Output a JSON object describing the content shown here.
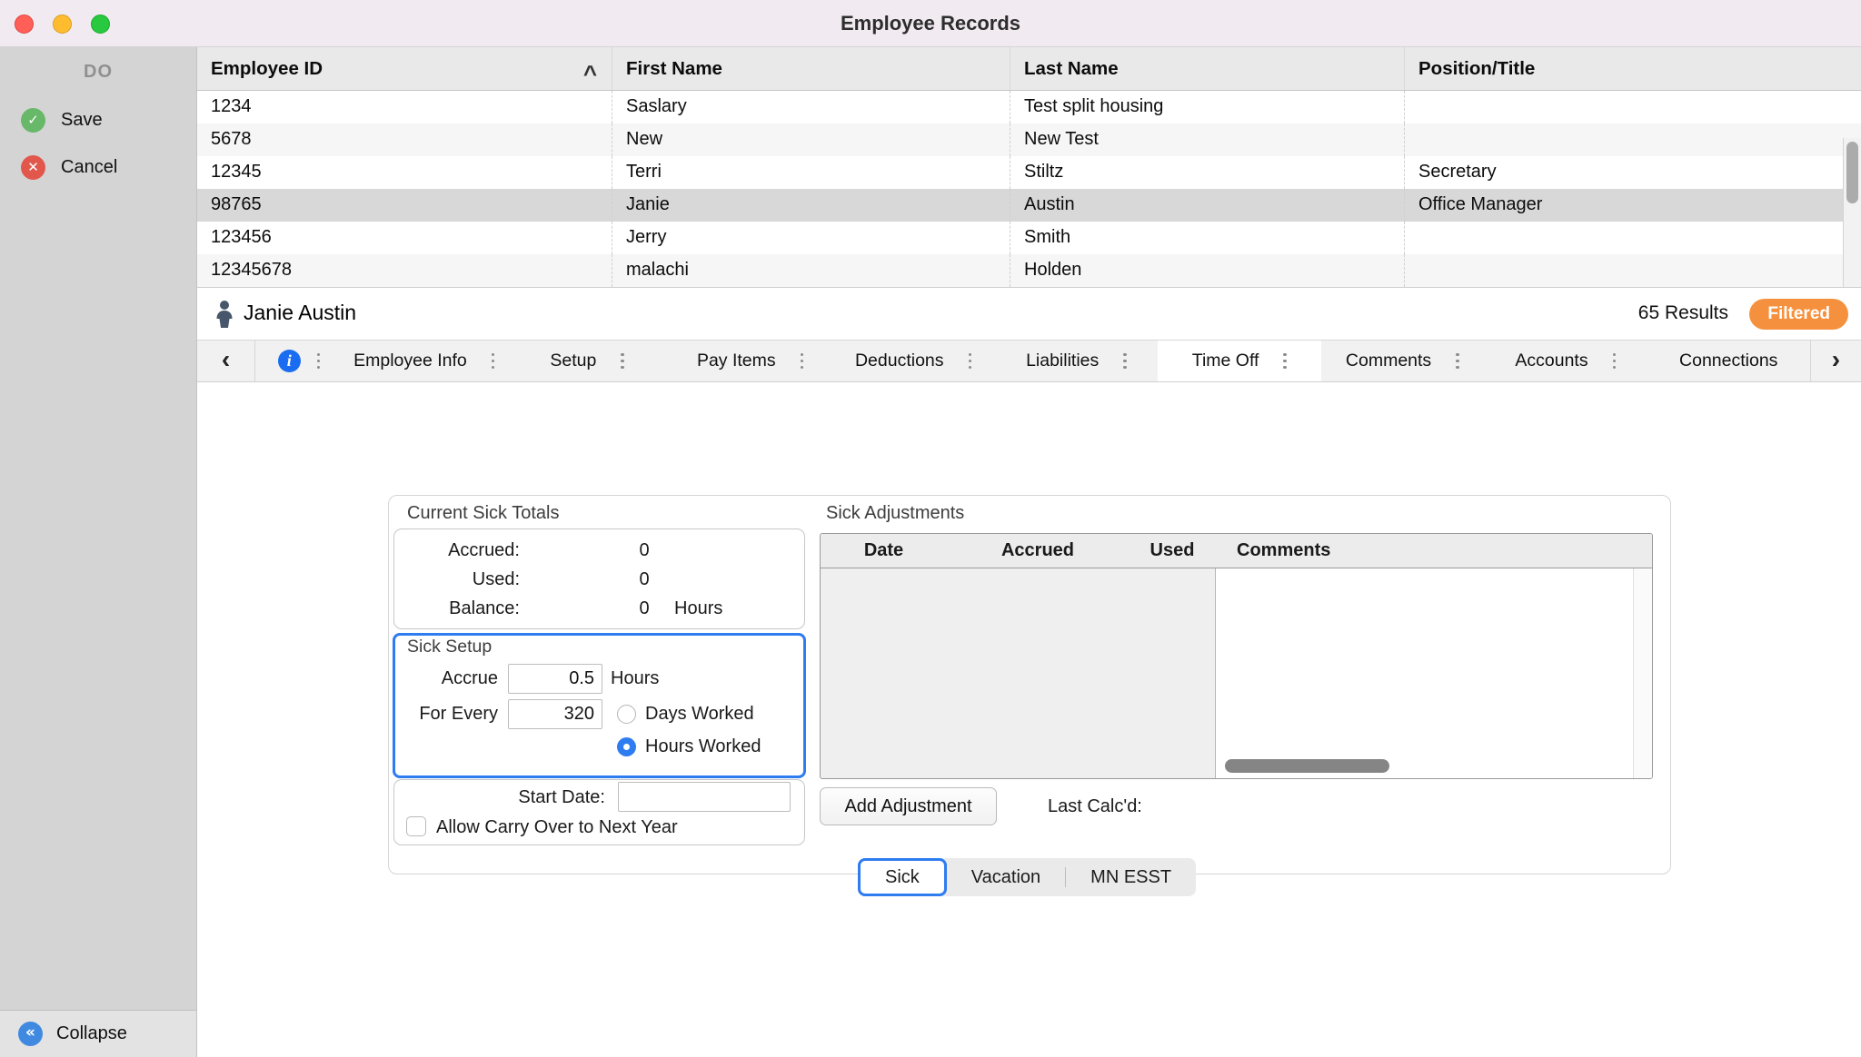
{
  "window": {
    "title": "Employee Records"
  },
  "sidebar": {
    "header": "DO",
    "save": "Save",
    "cancel": "Cancel",
    "collapse": "Collapse"
  },
  "table": {
    "columns": [
      "Employee ID",
      "First Name",
      "Last Name",
      "Position/Title"
    ],
    "sort_column": "Employee ID",
    "sort_direction": "ascending",
    "selected_row_index": 3,
    "rows": [
      [
        "1234",
        "Saslary",
        "Test split housing",
        ""
      ],
      [
        "5678",
        "New",
        "New Test",
        ""
      ],
      [
        "12345",
        "Terri",
        "Stiltz",
        "Secretary"
      ],
      [
        "98765",
        "Janie",
        "Austin",
        "Office Manager"
      ],
      [
        "123456",
        "Jerry",
        "Smith",
        ""
      ],
      [
        "12345678",
        "malachi",
        "Holden",
        ""
      ]
    ]
  },
  "record_bar": {
    "name": "Janie Austin",
    "results": "65 Results",
    "filter_badge": "Filtered"
  },
  "tab_bar": {
    "tabs": [
      "Employee Info",
      "Setup",
      "Pay Items",
      "Deductions",
      "Liabilities",
      "Time Off",
      "Comments",
      "Accounts",
      "Connections"
    ],
    "selected": "Time Off"
  },
  "content": {
    "totals": {
      "title": "Current Sick Totals",
      "rows": [
        {
          "label": "Accrued:",
          "value": "0",
          "unit": ""
        },
        {
          "label": "Used:",
          "value": "0",
          "unit": ""
        },
        {
          "label": "Balance:",
          "value": "0",
          "unit": "Hours"
        }
      ]
    },
    "setup": {
      "title": "Sick Setup",
      "accrue_label": "Accrue",
      "accrue_value": "0.5",
      "accrue_unit": "Hours",
      "for_every_label": "For Every",
      "for_every_value": "320",
      "days_worked": "Days Worked",
      "hours_worked": "Hours Worked",
      "selected_radio": "Hours Worked"
    },
    "start_date": {
      "label": "Start Date:",
      "value": ""
    },
    "carry_over": "Allow Carry Over to Next Year",
    "carry_over_checked": false,
    "adjustments": {
      "title": "Sick Adjustments",
      "columns": [
        "Date",
        "Accrued",
        "Used",
        "Comments"
      ],
      "add_button": "Add Adjustment",
      "last_calc": "Last Calc'd:"
    },
    "sub_tabs": [
      "Sick",
      "Vacation",
      "MN ESST"
    ],
    "selected_sub_tab": "Sick"
  },
  "colors": {
    "accent_blue": "#2e7cf0",
    "filtered_orange": "#f5913e",
    "save_green": "#67b868",
    "cancel_red": "#e2574c",
    "selected_row_gray": "#d8d8d8",
    "titlebar_pink": "#f1eaf1"
  }
}
